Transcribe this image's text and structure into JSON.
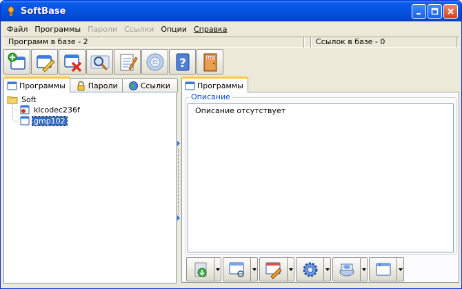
{
  "window": {
    "title": "SoftBase"
  },
  "menu": [
    {
      "label": "Файл",
      "enabled": true
    },
    {
      "label": "Программы",
      "enabled": true
    },
    {
      "label": "Пароли",
      "enabled": false
    },
    {
      "label": "Ссылки",
      "enabled": false
    },
    {
      "label": "Опции",
      "enabled": true
    },
    {
      "label": "Справка",
      "enabled": true
    }
  ],
  "status": {
    "programs_count": "Программ в базе - 2",
    "links_count": "Ссылок в базе - 0"
  },
  "toolbar_icons": [
    "add-program-icon",
    "edit-icon",
    "delete-icon",
    "search-icon",
    "notes-icon",
    "disc-icon",
    "help-icon",
    "exit-icon"
  ],
  "toolbar_exit_text": "EXIT",
  "left_tabs": [
    {
      "label": "Программы",
      "icon": "programs-icon",
      "active": true
    },
    {
      "label": "Пароли",
      "icon": "lock-icon",
      "active": false
    },
    {
      "label": "Ссылки",
      "icon": "globe-icon",
      "active": false
    }
  ],
  "tree": {
    "root": "Soft",
    "children": [
      {
        "label": "klcodec236f",
        "selected": false
      },
      {
        "label": "gmp102",
        "selected": true
      }
    ]
  },
  "right_tab": {
    "label": "Программы"
  },
  "description": {
    "group_label": "Описание",
    "text": "Описание отсутствует"
  },
  "colors": {
    "titlebar": "#0553e0",
    "selection": "#316ac5",
    "group_label": "#0046d5"
  }
}
